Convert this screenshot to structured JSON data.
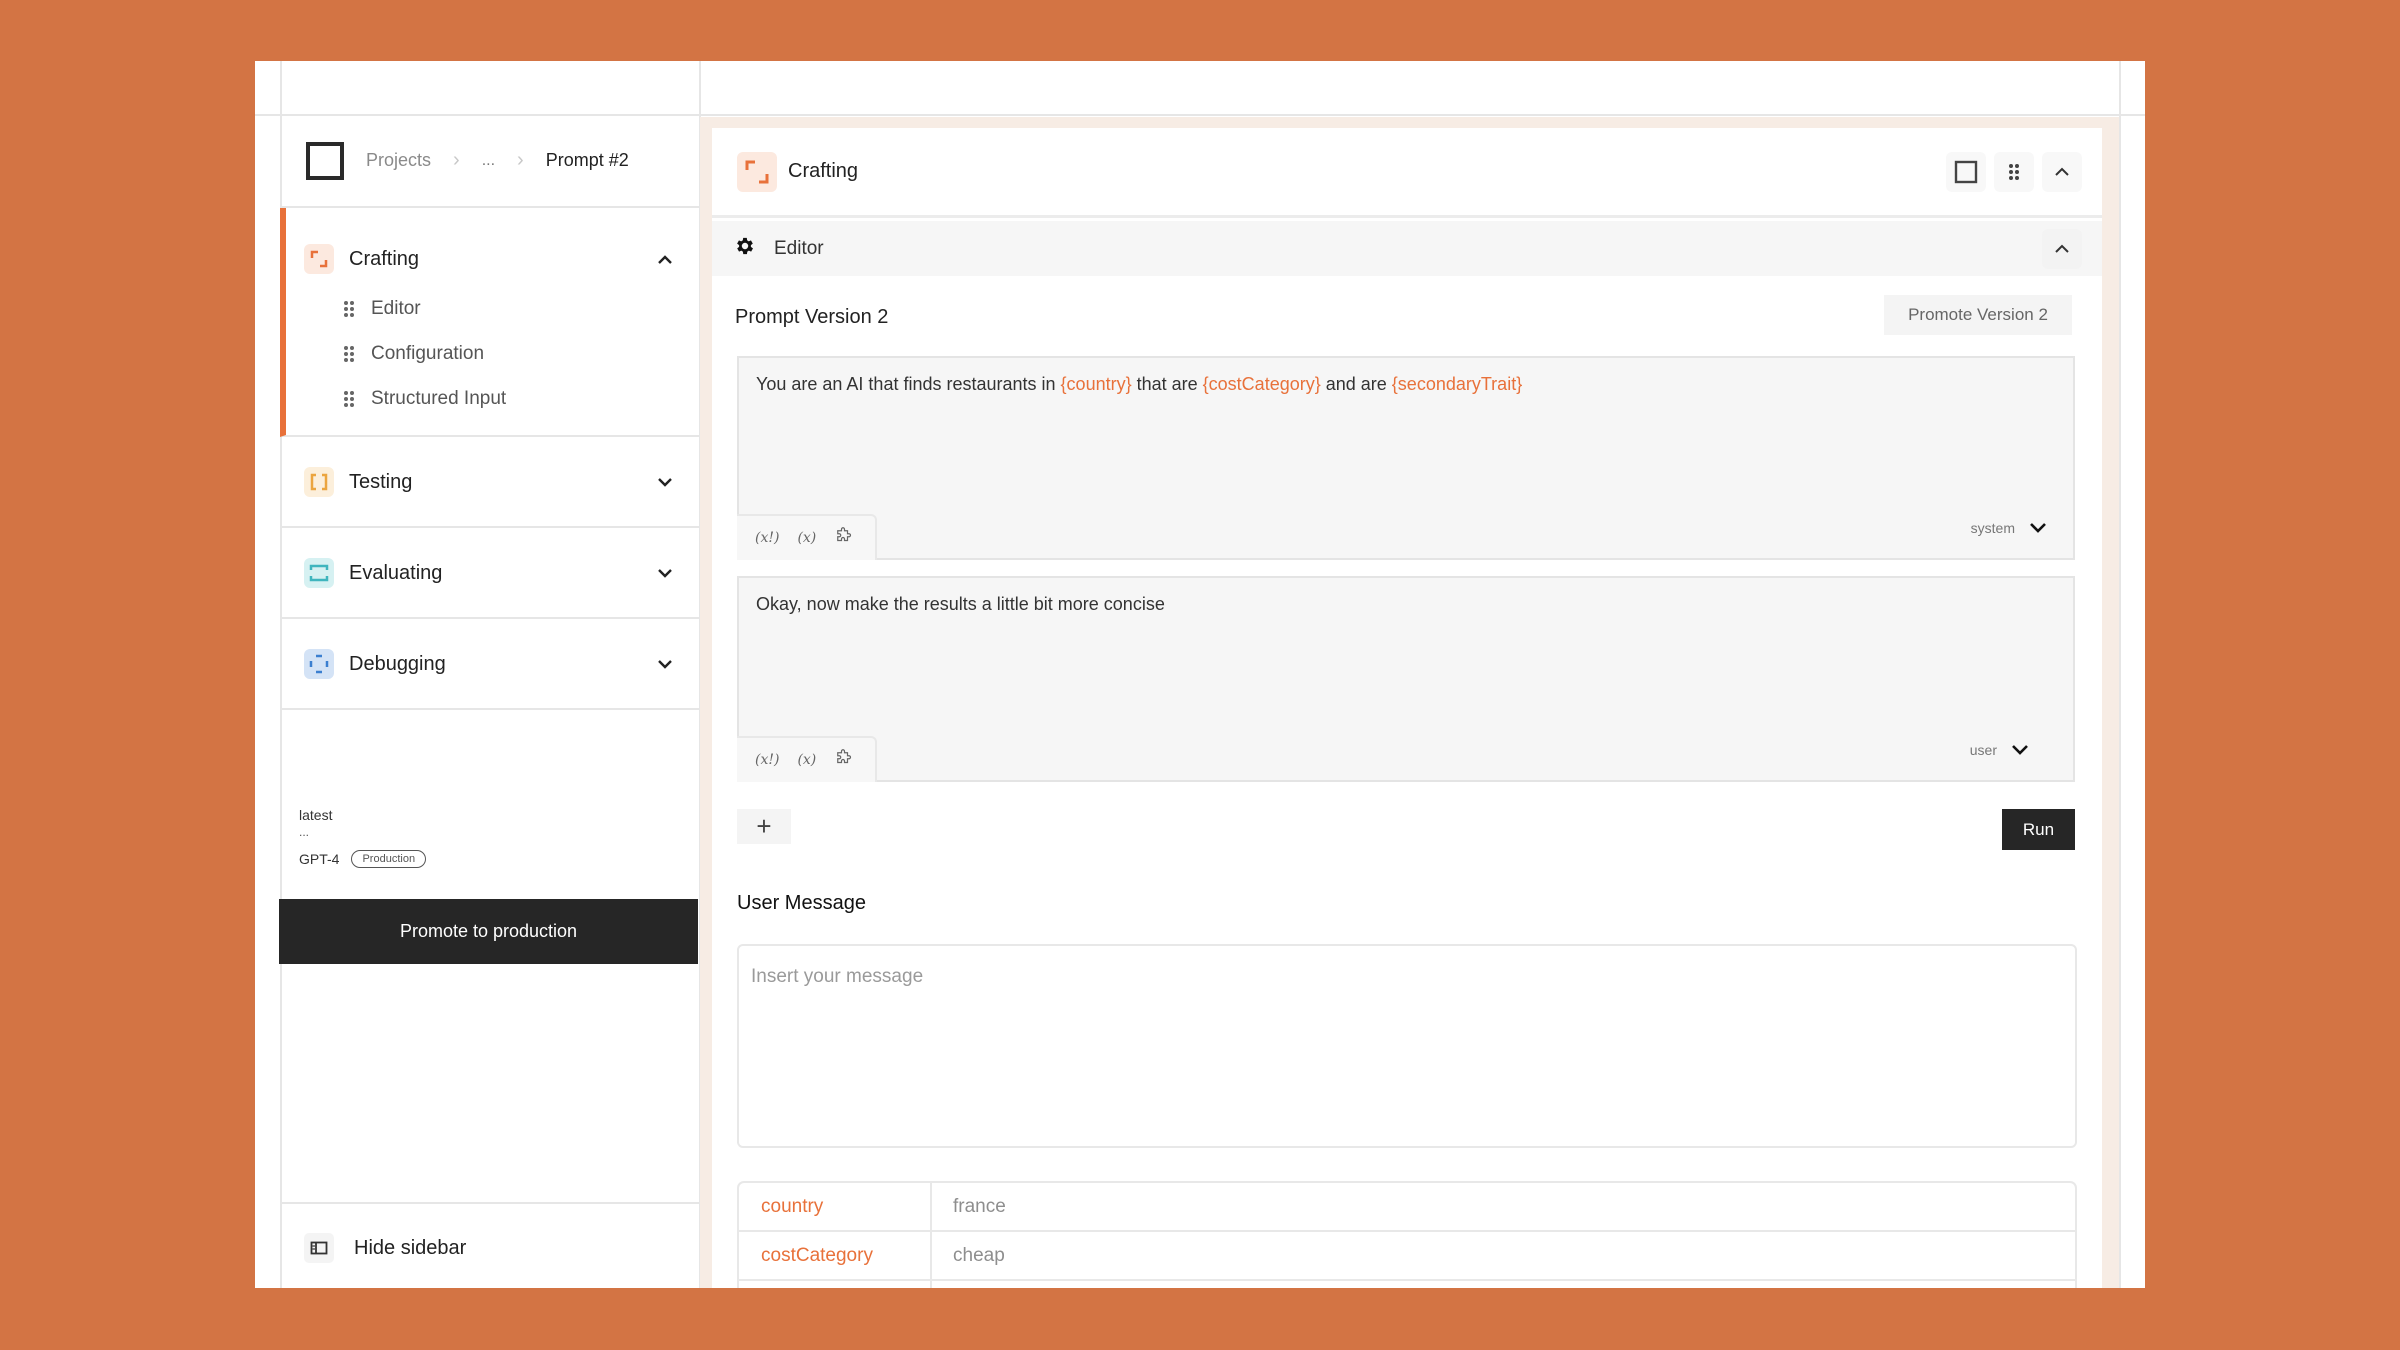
{
  "colors": {
    "background": "#D37444",
    "accent": "#E8713A",
    "crafting": "#E8713A",
    "testing": "#EBA53F",
    "evaluating": "#3FB5BE",
    "debugging": "#3B7FD0"
  },
  "breadcrumb": {
    "items": [
      "Projects",
      "...",
      "Prompt #2"
    ]
  },
  "sidebar": {
    "sections": [
      {
        "label": "Crafting",
        "icon": "crafting-icon",
        "expanded": true,
        "items": [
          {
            "label": "Editor"
          },
          {
            "label": "Configuration"
          },
          {
            "label": "Structured Input"
          }
        ]
      },
      {
        "label": "Testing",
        "icon": "testing-icon",
        "expanded": false
      },
      {
        "label": "Evaluating",
        "icon": "evaluating-icon",
        "expanded": false
      },
      {
        "label": "Debugging",
        "icon": "debugging-icon",
        "expanded": false
      }
    ],
    "version": {
      "tag": "latest",
      "ellipsis": "...",
      "model": "GPT-4",
      "badge": "Production"
    },
    "promote_button": "Promote to production",
    "hide_sidebar": "Hide sidebar"
  },
  "main": {
    "card_title": "Crafting",
    "editor_label": "Editor",
    "prompt_version_title": "Prompt Version 2",
    "promote_version_button": "Promote Version 2",
    "messages": [
      {
        "role": "system",
        "segments": [
          {
            "text": "You are an AI that finds restaurants in ",
            "var": false
          },
          {
            "text": "{country}",
            "var": true
          },
          {
            "text": " that are ",
            "var": false
          },
          {
            "text": "{costCategory}",
            "var": true
          },
          {
            "text": " and are ",
            "var": false
          },
          {
            "text": "{secondaryTrait}",
            "var": true
          }
        ]
      },
      {
        "role": "user",
        "segments": [
          {
            "text": "Okay, now make the results a little bit more concise",
            "var": false
          }
        ]
      }
    ],
    "tools": [
      "(x!)",
      "(x)"
    ],
    "add_button": "+",
    "run_button": "Run",
    "user_message_title": "User Message",
    "user_message_placeholder": "Insert your message",
    "user_message_value": "",
    "variables": [
      {
        "key": "country",
        "value": "france"
      },
      {
        "key": "costCategory",
        "value": "cheap"
      }
    ]
  }
}
